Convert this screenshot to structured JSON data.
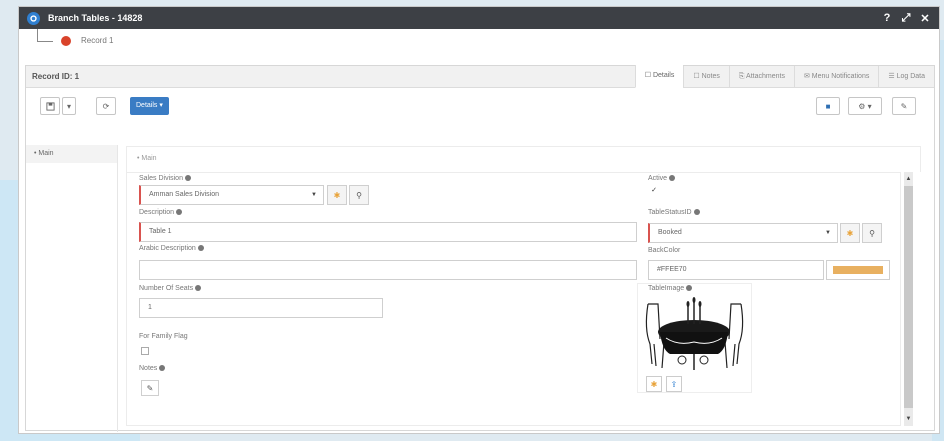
{
  "window": {
    "title": "Branch Tables - 14828"
  },
  "breadcrumb": {
    "record": "Record 1"
  },
  "panel": {
    "record_id": "Record ID: 1",
    "tabs": [
      {
        "label": "☐ Details",
        "active": true
      },
      {
        "label": "☐ Notes"
      },
      {
        "label": "⎘ Attachments"
      },
      {
        "label": "✉ Menu Notifications"
      },
      {
        "label": "☰ Log Data"
      }
    ]
  },
  "toolbar": {
    "details_label": "Details ▾"
  },
  "sidenav": {
    "main_label": "• Main"
  },
  "main": {
    "section_title": "• Main"
  },
  "form": {
    "sales_division": {
      "label": "Sales Division",
      "value": "Amman Sales Division"
    },
    "description": {
      "label": "Description",
      "value": "Table 1"
    },
    "arabic_description": {
      "label": "Arabic Description",
      "value": ""
    },
    "number_of_seats": {
      "label": "Number Of Seats",
      "value": "1"
    },
    "for_family_flag": {
      "label": "For Family Flag",
      "checked": false
    },
    "notes": {
      "label": "Notes"
    },
    "active": {
      "label": "Active",
      "checked": true
    },
    "table_status": {
      "label": "TableStatusID",
      "value": "Booked"
    },
    "back_color": {
      "label": "BackColor",
      "value": "#FFEE70",
      "swatch": "#e8b060"
    },
    "table_image": {
      "label": "TableImage"
    }
  },
  "colors": {
    "titlebar": "#3d4045",
    "primary": "#3a7cc4",
    "required": "#d9534f",
    "accent": "#e8a33a"
  }
}
